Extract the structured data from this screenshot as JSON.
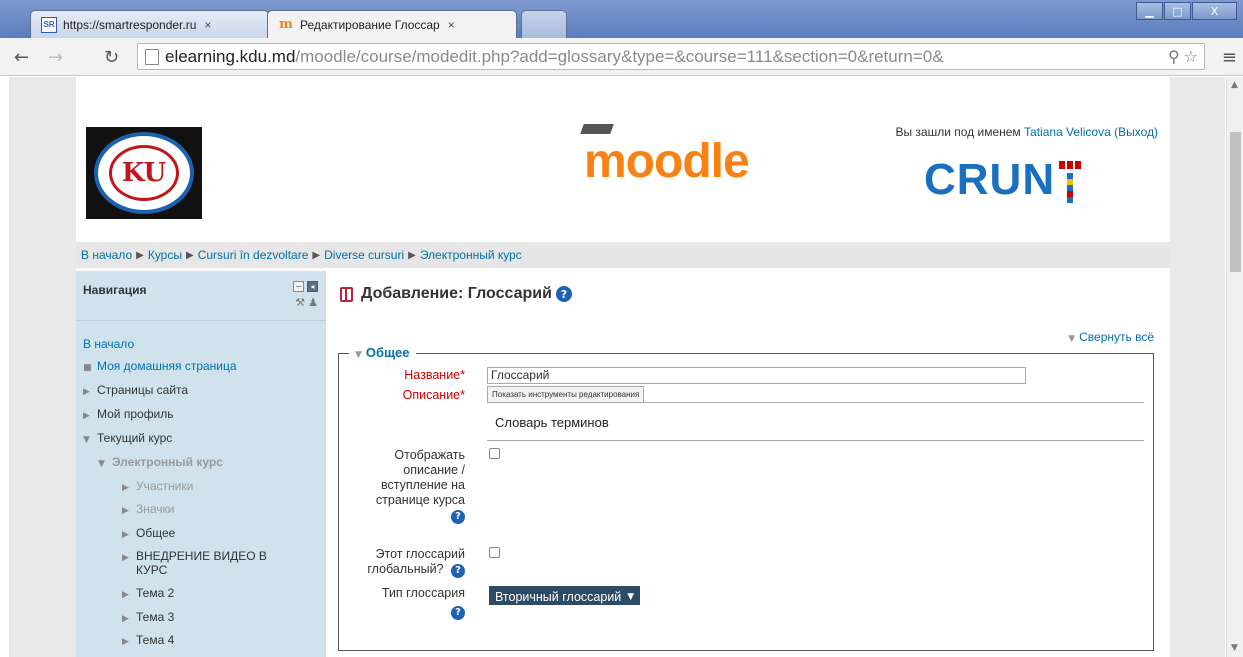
{
  "browser": {
    "tabs": [
      {
        "icon": "SR",
        "title": "https://smartresponder.ru",
        "close": "×"
      },
      {
        "icon": "m",
        "title": "Редактирование Глоссар",
        "close": "×"
      }
    ],
    "url_domain": "elearning.kdu.md",
    "url_rest": "/moodle/course/modedit.php?add=glossary&type=&course=111&section=0&return=0&",
    "window_controls": {
      "minimize": "▁",
      "maximize": "□",
      "close": "X"
    }
  },
  "header": {
    "login_prefix": "Вы зашли под именем",
    "user_name": "Tatiana Velicova",
    "logout": "(Выход)",
    "moodle_logo": "moodle",
    "crunt_logo": "CRUN",
    "kdu_logo": "KU"
  },
  "breadcrumb": {
    "items": [
      "В начало",
      "Курсы",
      "Cursuri în dezvoltare",
      "Diverse cursuri",
      "Электронный курс"
    ],
    "separator": "▶"
  },
  "sidebar": {
    "title": "Навигация",
    "items": [
      {
        "label": "В начало"
      },
      {
        "label": "Моя домашняя страница",
        "bullet": "■"
      },
      {
        "label": "Страницы сайта",
        "bullet": "▶"
      },
      {
        "label": "Мой профиль",
        "bullet": "▶"
      },
      {
        "label": "Текущий курс",
        "bullet": "▼"
      },
      {
        "label": "Электронный курс",
        "bullet": "▼"
      },
      {
        "label": "Участники",
        "bullet": "▶"
      },
      {
        "label": "Значки",
        "bullet": "▶"
      },
      {
        "label": "Общее",
        "bullet": "▶"
      },
      {
        "label": "ВНЕДРЕНИЕ ВИДЕО В",
        "bullet": "▶"
      },
      {
        "label": "КУРС"
      },
      {
        "label": "Тема 2",
        "bullet": "▶"
      },
      {
        "label": "Тема 3",
        "bullet": "▶"
      },
      {
        "label": "Тема 4",
        "bullet": "▶"
      }
    ]
  },
  "main": {
    "heading": "Добавление: Глоссарий",
    "collapse_all": "Свернуть всё",
    "section_title": "Общее",
    "fields": {
      "name_label": "Название",
      "name_value": "Глоссарий",
      "description_label": "Описание",
      "editor_toggle": "Показать инструменты редактирования",
      "description_value": "Словарь терминов",
      "show_description_label": [
        "Отображать",
        "описание /",
        "вступление на",
        "странице курса"
      ],
      "global_label": [
        "Этот глоссарий",
        "глобальный?"
      ],
      "type_label": "Тип глоссария",
      "type_value": "Вторичный глоссарий"
    }
  }
}
